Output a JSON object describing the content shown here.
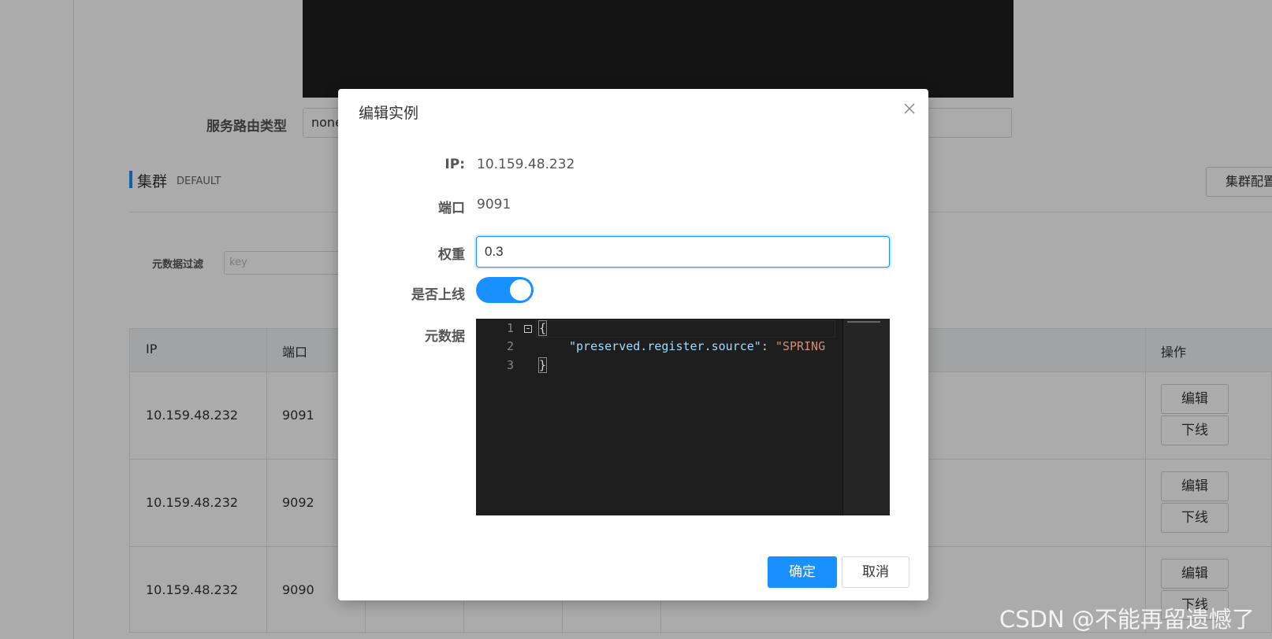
{
  "background": {
    "route_type_label": "服务路由类型",
    "route_type_value": "none",
    "cluster_title": "集群",
    "cluster_name": "DEFAULT",
    "cluster_config_button": "集群配置",
    "metadata_filter_label": "元数据过滤",
    "metadata_filter_placeholder": "key",
    "table": {
      "headers": {
        "ip": "IP",
        "port": "端口",
        "actions": "操作"
      },
      "rows": [
        {
          "ip": "10.159.48.232",
          "port": "9091"
        },
        {
          "ip": "10.159.48.232",
          "port": "9092"
        },
        {
          "ip": "10.159.48.232",
          "port": "9090"
        }
      ],
      "edit_button": "编辑",
      "offline_button": "下线"
    }
  },
  "dialog": {
    "title": "编辑实例",
    "ip_label": "IP:",
    "ip_value": "10.159.48.232",
    "port_label": "端口",
    "port_value": "9091",
    "weight_label": "权重",
    "weight_value": "0.3",
    "online_label": "是否上线",
    "online_enabled": true,
    "metadata_label": "元数据",
    "metadata_lines": [
      {
        "no": "1",
        "text": "{"
      },
      {
        "no": "2",
        "key": "\"preserved.register.source\"",
        "sep": ": ",
        "value": "\"SPRING"
      },
      {
        "no": "3",
        "text": "}"
      }
    ],
    "confirm_button": "确定",
    "cancel_button": "取消"
  },
  "watermark": "CSDN @不能再留遗憾了",
  "colors": {
    "accent": "#1890ff",
    "editor_bg": "#1e1e1e",
    "json_key": "#9cdcfe",
    "json_string": "#ce9178"
  }
}
